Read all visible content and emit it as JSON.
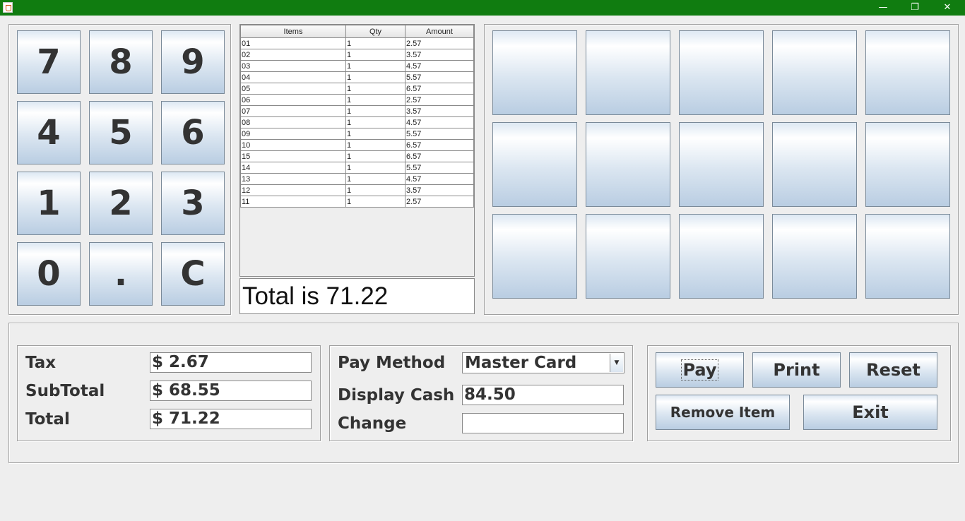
{
  "window": {
    "icon": "java-cup-icon",
    "controls": {
      "minimize": "—",
      "restore": "❐",
      "close": "✕"
    },
    "title_bar_color": "#107c10"
  },
  "keypad": {
    "keys": [
      "7",
      "8",
      "9",
      "4",
      "5",
      "6",
      "1",
      "2",
      "3",
      "0",
      ".",
      "C"
    ]
  },
  "order_table": {
    "columns": [
      "Items",
      "Qty",
      "Amount"
    ],
    "rows": [
      [
        "01",
        "1",
        "2.57"
      ],
      [
        "02",
        "1",
        "3.57"
      ],
      [
        "03",
        "1",
        "4.57"
      ],
      [
        "04",
        "1",
        "5.57"
      ],
      [
        "05",
        "1",
        "6.57"
      ],
      [
        "06",
        "1",
        "2.57"
      ],
      [
        "07",
        "1",
        "3.57"
      ],
      [
        "08",
        "1",
        "4.57"
      ],
      [
        "09",
        "1",
        "5.57"
      ],
      [
        "10",
        "1",
        "6.57"
      ],
      [
        "15",
        "1",
        "6.57"
      ],
      [
        "14",
        "1",
        "5.57"
      ],
      [
        "13",
        "1",
        "4.57"
      ],
      [
        "12",
        "1",
        "3.57"
      ],
      [
        "11",
        "1",
        "2.57"
      ]
    ]
  },
  "total_display": "Total is 71.22",
  "products": {
    "count": 15
  },
  "summary": {
    "tax_label": "Tax",
    "tax_value": "$ 2.67",
    "subtotal_label": "SubTotal",
    "subtotal_value": "$ 68.55",
    "total_label": "Total",
    "total_value": "$ 71.22"
  },
  "payment": {
    "method_label": "Pay Method",
    "method_value": "Master Card",
    "cash_label": "Display Cash",
    "cash_value": "84.50",
    "change_label": "Change",
    "change_value": ""
  },
  "actions": {
    "pay": "Pay",
    "print": "Print",
    "reset": "Reset",
    "remove": "Remove Item",
    "exit": "Exit"
  }
}
